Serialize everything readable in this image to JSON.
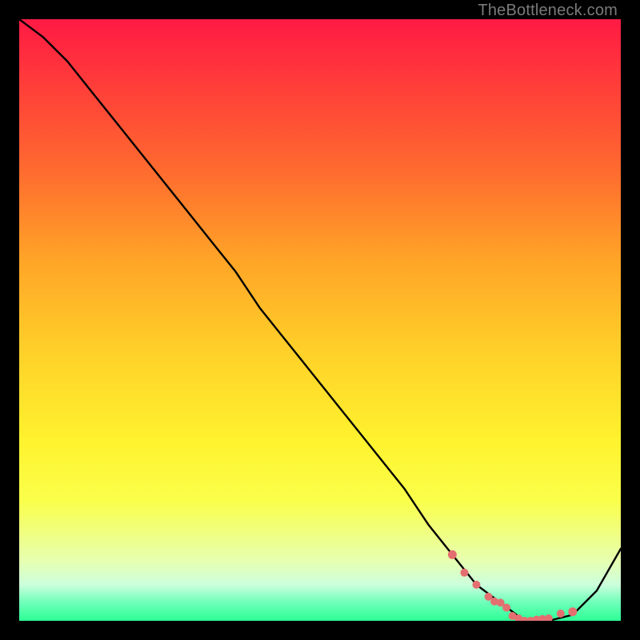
{
  "watermark": "TheBottleneck.com",
  "colors": {
    "bg": "#000000",
    "curve_stroke": "#000000",
    "dot_fill": "#e46f70",
    "dot_stroke": "#e46f70"
  },
  "chart_data": {
    "type": "line",
    "title": "",
    "xlabel": "",
    "ylabel": "",
    "xlim": [
      0,
      100
    ],
    "ylim": [
      0,
      100
    ],
    "grid": false,
    "legend": false,
    "series": [
      {
        "name": "bottleneck-curve",
        "x": [
          0,
          4,
          8,
          12,
          16,
          20,
          24,
          28,
          32,
          36,
          40,
          44,
          48,
          52,
          56,
          60,
          64,
          68,
          72,
          76,
          80,
          84,
          88,
          92,
          96,
          100
        ],
        "y": [
          100,
          97,
          93,
          88,
          83,
          78,
          73,
          68,
          63,
          58,
          52,
          47,
          42,
          37,
          32,
          27,
          22,
          16,
          11,
          6,
          3,
          0,
          0,
          1,
          5,
          12
        ]
      }
    ],
    "highlighted_points": {
      "name": "optimal-range-dots",
      "x": [
        72,
        74,
        76,
        78,
        79,
        80,
        81,
        82,
        83,
        84,
        85,
        86,
        87,
        88,
        90,
        92
      ],
      "y": [
        11,
        8,
        6,
        4,
        3.2,
        3,
        2.2,
        0.8,
        0.4,
        0,
        0,
        0.2,
        0.3,
        0.4,
        1.2,
        1.5
      ]
    }
  }
}
